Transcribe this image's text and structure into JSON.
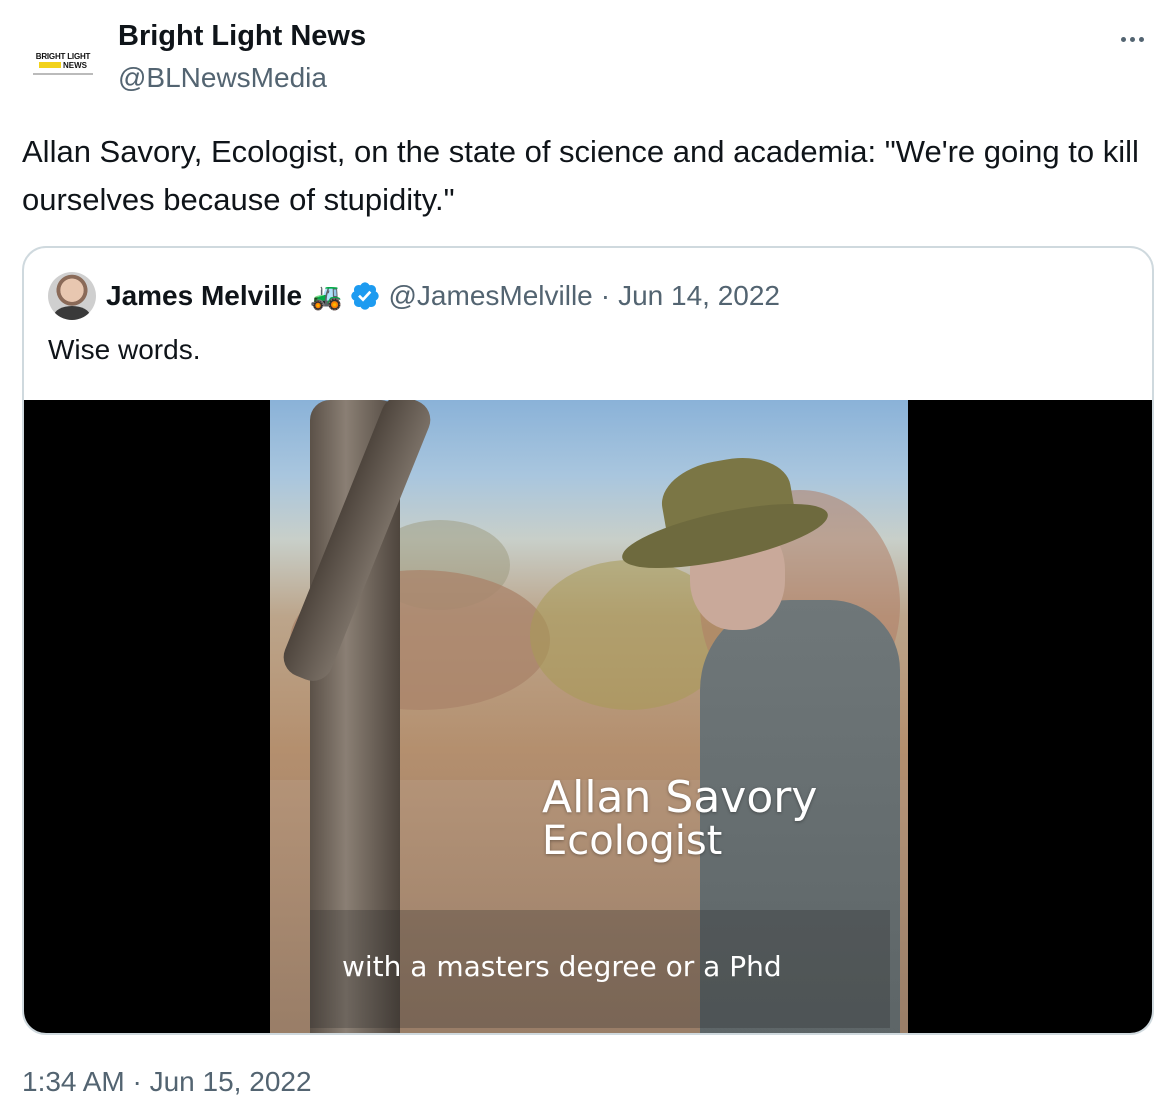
{
  "author": {
    "name": "Bright Light News",
    "handle": "@BLNewsMedia",
    "avatar_logo": {
      "line1": "BRIGHT LIGHT",
      "line2": "NEWS",
      "accent": "#f2d21b"
    }
  },
  "more_icon": "more-horizontal-icon",
  "tweet_text": "Allan Savory, Ecologist, on the state of science and academia: \"We're going to kill ourselves because of stupidity.\"",
  "quote": {
    "name": "James Melville",
    "emoji": "🚜",
    "verified_icon": "verified-badge-icon",
    "verified_color": "#1d9bf0",
    "handle": "@JamesMelville",
    "separator": "·",
    "date": "Jun 14, 2022",
    "text": "Wise words.",
    "video": {
      "caption_name": "Allan Savory",
      "caption_role": "Ecologist",
      "subtitle": "with a masters degree or a Phd"
    }
  },
  "timestamp": "1:34 AM · Jun 15, 2022",
  "colors": {
    "text": "#0f1419",
    "secondary": "#536471",
    "border": "#cfd9de"
  }
}
